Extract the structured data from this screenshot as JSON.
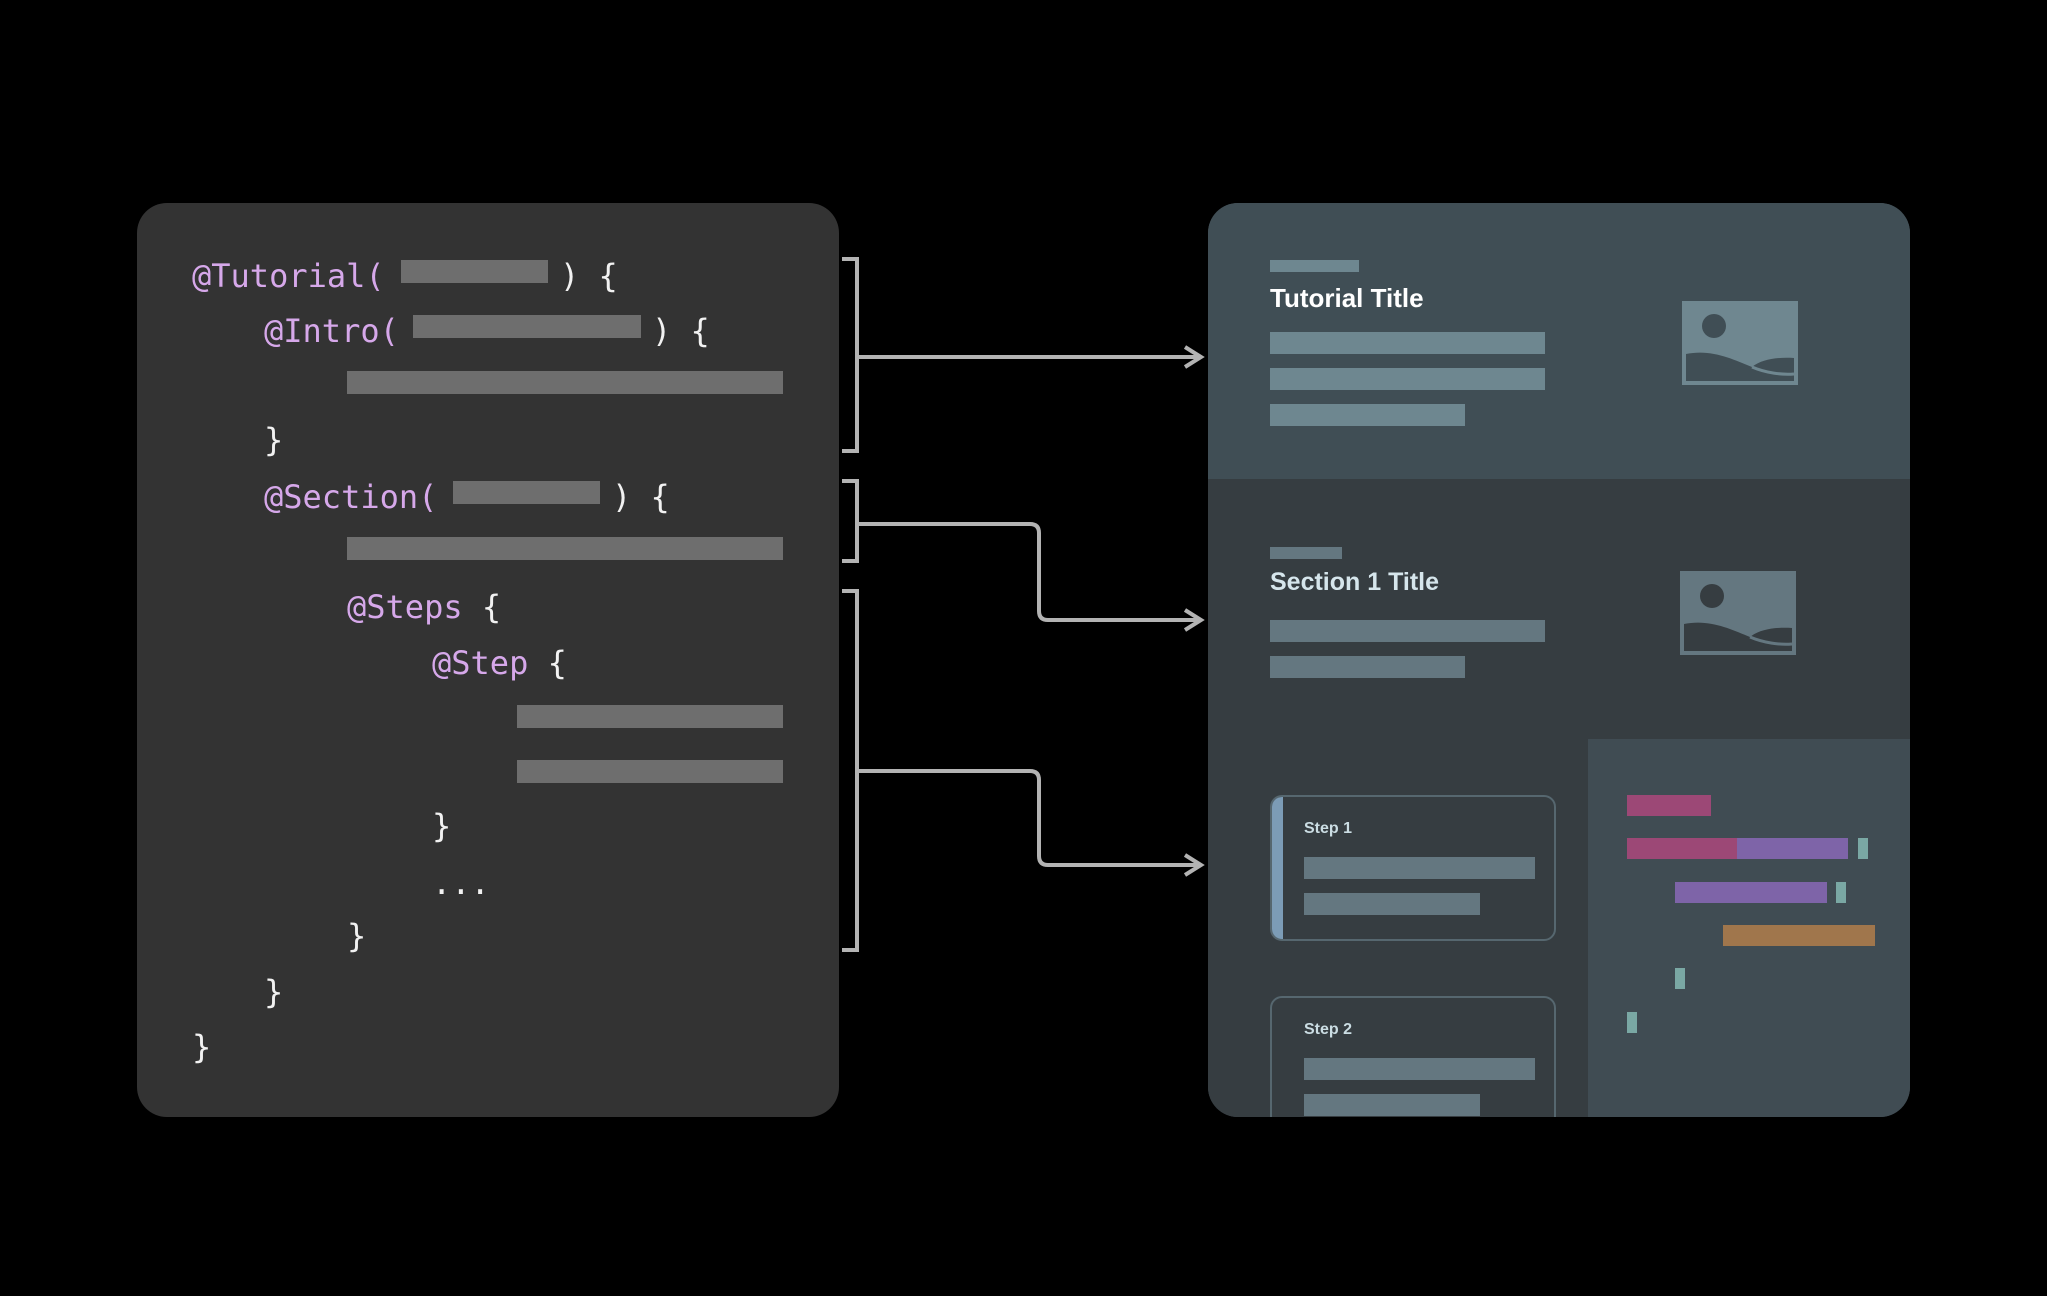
{
  "code": {
    "lines": [
      {
        "keyword": "@Tutorial(",
        "suffix": ") {"
      },
      {
        "keyword": "@Intro(",
        "suffix": ") {"
      },
      {
        "text": "}"
      },
      {
        "keyword": "@Section(",
        "suffix": ") {"
      },
      {
        "keyword": "@Steps",
        "suffix": " {"
      },
      {
        "keyword": "@Step",
        "suffix": " {"
      },
      {
        "text": "}"
      },
      {
        "text": "..."
      },
      {
        "text": "}"
      },
      {
        "text": "}"
      },
      {
        "text": "}"
      }
    ]
  },
  "rendered": {
    "intro": {
      "title": "Tutorial Title"
    },
    "section": {
      "title": "Section 1 Title"
    },
    "steps": [
      {
        "label": "Step 1",
        "active": true
      },
      {
        "label": "Step 2",
        "active": false
      }
    ]
  },
  "colors": {
    "keyword": "#d6a8ea",
    "connector": "#b3b3b3",
    "step_accent": "#7c9cb6",
    "code_magenta": "#9c4876",
    "code_purple": "#7e64a8",
    "code_teal": "#7aa8a4",
    "code_orange": "#a0764c"
  }
}
